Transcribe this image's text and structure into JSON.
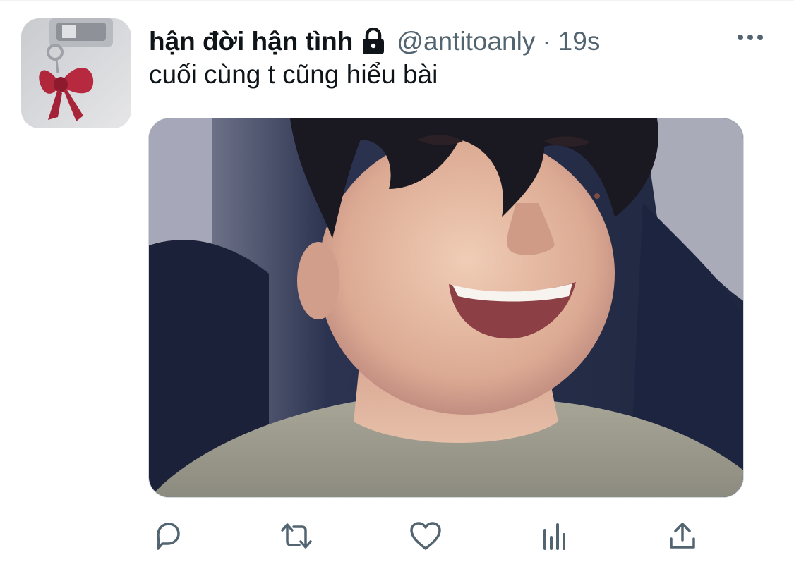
{
  "tweet": {
    "display_name": "hận đời hận tình",
    "protected_icon": "lock-icon",
    "handle": "@antitoanly",
    "separator": "·",
    "time": "19s",
    "text": "cuối cùng t cũng hiểu bài",
    "more_icon": "more-horizontal-icon",
    "media": {
      "kind": "photo",
      "subject": "smiling person with dark hair and grey t-shirt"
    }
  },
  "actions": [
    {
      "name": "reply",
      "icon": "reply-icon"
    },
    {
      "name": "retweet",
      "icon": "retweet-icon"
    },
    {
      "name": "like",
      "icon": "heart-icon"
    },
    {
      "name": "views",
      "icon": "analytics-icon"
    },
    {
      "name": "share",
      "icon": "share-icon"
    }
  ],
  "colors": {
    "text_primary": "#0f1419",
    "text_secondary": "#536471",
    "icon": "#536471",
    "background": "#ffffff"
  }
}
